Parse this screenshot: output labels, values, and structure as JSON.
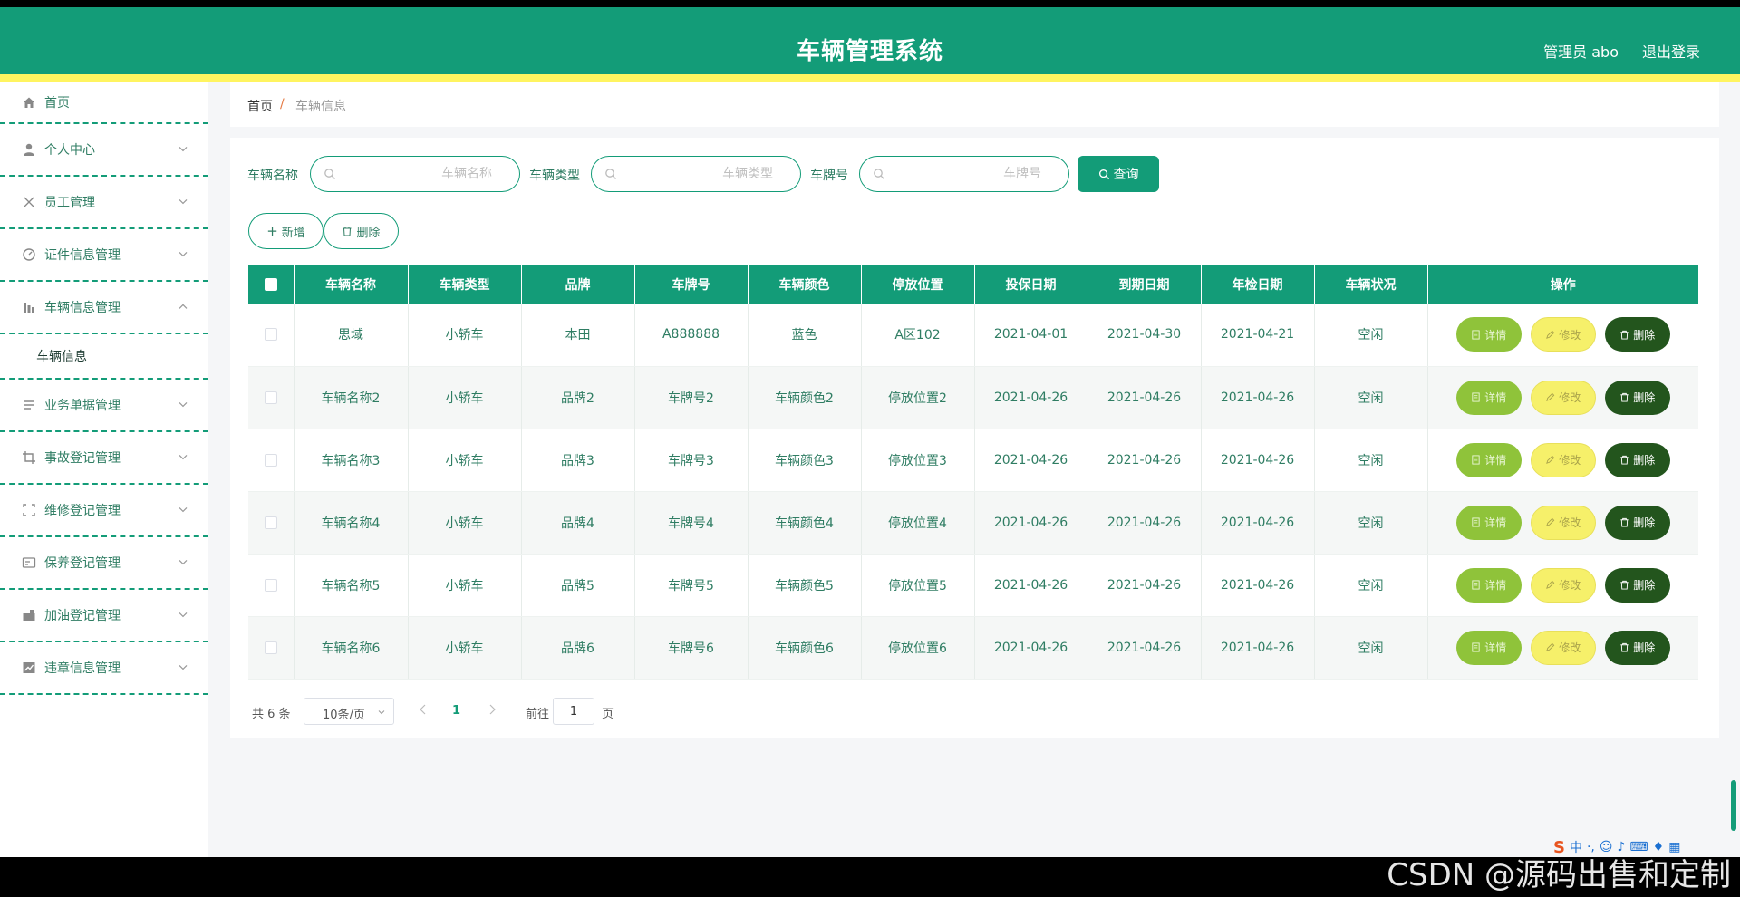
{
  "header": {
    "title": "车辆管理系统",
    "user": "管理员 abo",
    "logout": "退出登录"
  },
  "sidebar": {
    "items": [
      {
        "label": "首页",
        "icon": "home-icon"
      },
      {
        "label": "个人中心",
        "icon": "user-icon"
      },
      {
        "label": "员工管理",
        "icon": "staff-icon"
      },
      {
        "label": "证件信息管理",
        "icon": "certificate-icon"
      },
      {
        "label": "车辆信息管理",
        "icon": "vehicle-icon"
      },
      {
        "label": "业务单据管理",
        "icon": "document-icon"
      },
      {
        "label": "事故登记管理",
        "icon": "crop-icon"
      },
      {
        "label": "维修登记管理",
        "icon": "scan-icon"
      },
      {
        "label": "保养登记管理",
        "icon": "card-icon"
      },
      {
        "label": "加油登记管理",
        "icon": "fuel-icon"
      },
      {
        "label": "违章信息管理",
        "icon": "chart-icon"
      }
    ],
    "submenu": {
      "label": "车辆信息"
    }
  },
  "breadcrumb": {
    "home": "首页",
    "separator": "/",
    "current": "车辆信息"
  },
  "search": {
    "name_label": "车辆名称",
    "name_placeholder": "车辆名称",
    "type_label": "车辆类型",
    "type_placeholder": "车辆类型",
    "plate_label": "车牌号",
    "plate_placeholder": "车牌号",
    "query_button": "查询"
  },
  "actions": {
    "add_button": "新增",
    "delete_button": "删除"
  },
  "table": {
    "headers": [
      "车辆名称",
      "车辆类型",
      "品牌",
      "车牌号",
      "车辆颜色",
      "停放位置",
      "投保日期",
      "到期日期",
      "年检日期",
      "车辆状况",
      "操作"
    ],
    "rows": [
      [
        "思域",
        "小轿车",
        "本田",
        "A888888",
        "蓝色",
        "A区102",
        "2021-04-01",
        "2021-04-30",
        "2021-04-21",
        "空闲"
      ],
      [
        "车辆名称2",
        "小轿车",
        "品牌2",
        "车牌号2",
        "车辆颜色2",
        "停放位置2",
        "2021-04-26",
        "2021-04-26",
        "2021-04-26",
        "空闲"
      ],
      [
        "车辆名称3",
        "小轿车",
        "品牌3",
        "车牌号3",
        "车辆颜色3",
        "停放位置3",
        "2021-04-26",
        "2021-04-26",
        "2021-04-26",
        "空闲"
      ],
      [
        "车辆名称4",
        "小轿车",
        "品牌4",
        "车牌号4",
        "车辆颜色4",
        "停放位置4",
        "2021-04-26",
        "2021-04-26",
        "2021-04-26",
        "空闲"
      ],
      [
        "车辆名称5",
        "小轿车",
        "品牌5",
        "车牌号5",
        "车辆颜色5",
        "停放位置5",
        "2021-04-26",
        "2021-04-26",
        "2021-04-26",
        "空闲"
      ],
      [
        "车辆名称6",
        "小轿车",
        "品牌6",
        "车牌号6",
        "车辆颜色6",
        "停放位置6",
        "2021-04-26",
        "2021-04-26",
        "2021-04-26",
        "空闲"
      ]
    ],
    "row_actions": {
      "detail": "详情",
      "edit": "修改",
      "delete": "删除"
    }
  },
  "pagination": {
    "total": "共 6 条",
    "page_size": "10条/页",
    "current_page": "1",
    "goto_prefix": "前往",
    "goto_value": "1",
    "goto_suffix": "页"
  },
  "ime": {
    "label": "中"
  },
  "watermark": "CSDN @源码出售和定制",
  "colors": {
    "primary": "#139c78",
    "accent_stripe": "#fff460",
    "detail_button": "#8fc33a",
    "edit_button": "#f6f06a",
    "delete_button": "#23551d",
    "background": "#f5f6f8"
  }
}
